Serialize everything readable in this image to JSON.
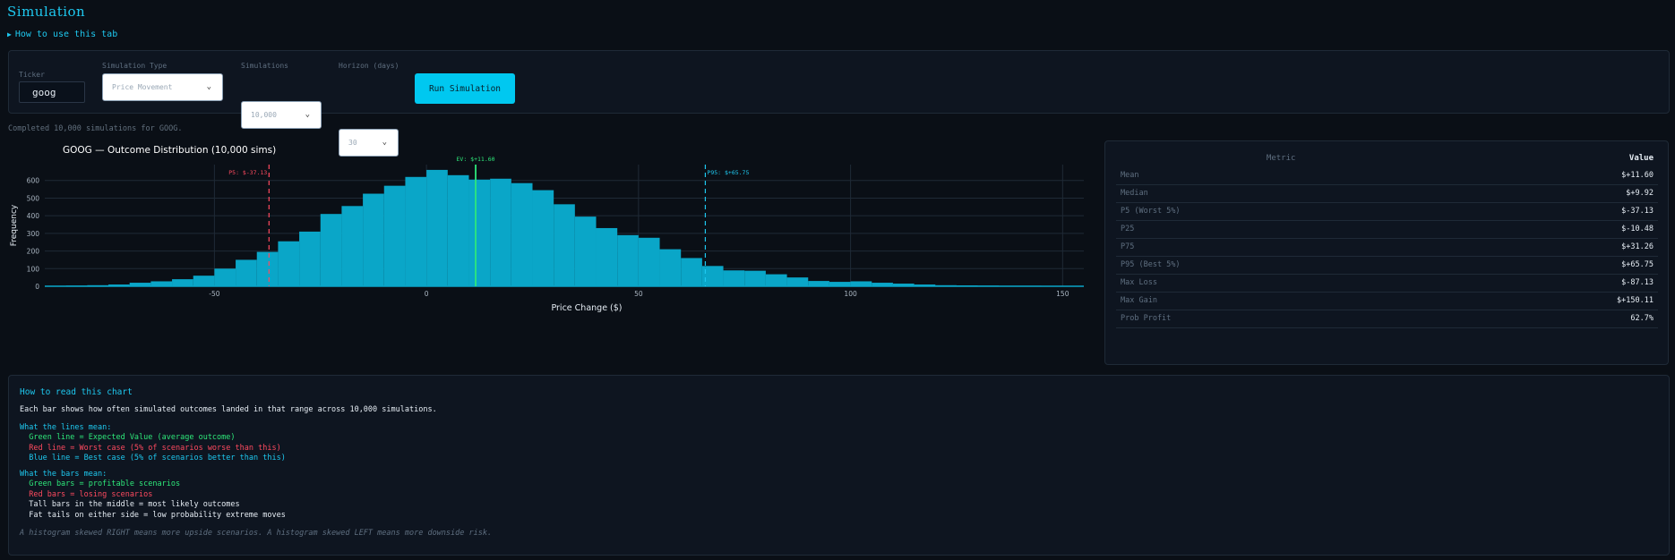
{
  "page": {
    "title": "Simulation",
    "how_to_label": "How to use this tab",
    "status_text": "Completed 10,000 simulations for GOOG."
  },
  "controls": {
    "ticker_label": "Ticker",
    "ticker_value": "goog",
    "sim_type_label": "Simulation Type",
    "sim_type_value": "Price Movement",
    "simulations_label": "Simulations",
    "simulations_value": "10,000",
    "horizon_label": "Horizon (days)",
    "horizon_value": "30",
    "run_label": "Run Simulation"
  },
  "chart_data": {
    "type": "bar",
    "title": "GOOG — Outcome Distribution (10,000 sims)",
    "xlabel": "Price Change ($)",
    "ylabel": "Frequency",
    "xlim": [
      -90,
      155
    ],
    "ylim": [
      0,
      690
    ],
    "x_ticks": [
      -50,
      0,
      50,
      100,
      150
    ],
    "y_ticks": [
      0,
      100,
      200,
      300,
      400,
      500,
      600
    ],
    "bin_width": 5,
    "bin_starts": [
      -90,
      -85,
      -80,
      -75,
      -70,
      -65,
      -60,
      -55,
      -50,
      -45,
      -40,
      -35,
      -30,
      -25,
      -20,
      -15,
      -10,
      -5,
      0,
      5,
      10,
      15,
      20,
      25,
      30,
      35,
      40,
      45,
      50,
      55,
      60,
      65,
      70,
      75,
      80,
      85,
      90,
      95,
      100,
      105,
      110,
      115,
      120,
      125,
      130,
      135,
      140,
      145,
      150
    ],
    "values": [
      3,
      4,
      6,
      10,
      20,
      28,
      40,
      60,
      100,
      150,
      195,
      255,
      310,
      410,
      455,
      525,
      570,
      620,
      660,
      630,
      605,
      610,
      585,
      545,
      465,
      395,
      330,
      290,
      275,
      210,
      160,
      115,
      90,
      88,
      68,
      50,
      30,
      25,
      28,
      20,
      15,
      10,
      6,
      5,
      4,
      3,
      3,
      2,
      2
    ],
    "bar_color": "#0aa6c8",
    "grid": true,
    "markers": [
      {
        "name": "P5",
        "label": "P5: $-37.13",
        "x": -37.13,
        "color": "#ff4a5f",
        "style": "dashed"
      },
      {
        "name": "EV",
        "label": "EV: $+11.60",
        "x": 11.6,
        "color": "#2ee87a",
        "style": "solid"
      },
      {
        "name": "P95",
        "label": "P95: $+65.75",
        "x": 65.75,
        "color": "#1ec8ef",
        "style": "dashed"
      }
    ]
  },
  "stats": {
    "header_metric": "Metric",
    "header_value": "Value",
    "rows": [
      {
        "metric": "Mean",
        "value": "$+11.60"
      },
      {
        "metric": "Median",
        "value": "$+9.92"
      },
      {
        "metric": "P5 (Worst 5%)",
        "value": "$-37.13"
      },
      {
        "metric": "P25",
        "value": "$-10.48"
      },
      {
        "metric": "P75",
        "value": "$+31.26"
      },
      {
        "metric": "P95 (Best 5%)",
        "value": "$+65.75"
      },
      {
        "metric": "Max Loss",
        "value": "$-87.13"
      },
      {
        "metric": "Max Gain",
        "value": "$+150.11"
      },
      {
        "metric": "Prob Profit",
        "value": "62.7%"
      }
    ]
  },
  "explain": {
    "heading": "How to read this chart",
    "intro": "Each bar shows how often simulated outcomes landed in that range across 10,000 simulations.",
    "lines_heading": "What the lines mean:",
    "line_green": "  Green line = Expected Value (average outcome)",
    "line_red": "  Red line = Worst case (5% of scenarios worse than this)",
    "line_blue": "  Blue line = Best case (5% of scenarios better than this)",
    "bars_heading": "What the bars mean:",
    "bar_green": "  Green bars = profitable scenarios",
    "bar_red": "  Red bars = losing scenarios",
    "bar_tall": "  Tall bars in the middle = most likely outcomes",
    "bar_fat": "  Fat tails on either side = low probability extreme moves",
    "footer": "A histogram skewed RIGHT means more upside scenarios. A histogram skewed LEFT means more downside risk."
  }
}
